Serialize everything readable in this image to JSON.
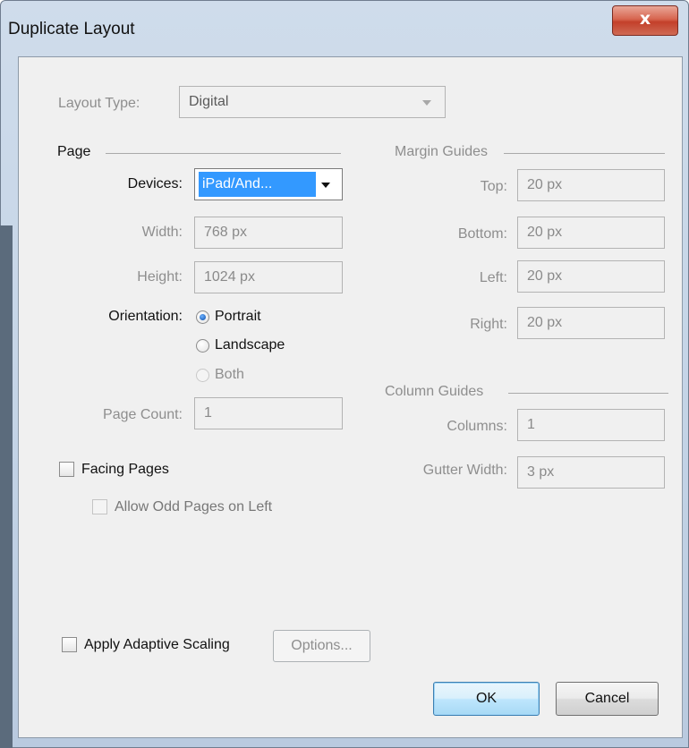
{
  "window": {
    "title": "Duplicate Layout",
    "close_glyph": "x"
  },
  "layout_type": {
    "label": "Layout Type:",
    "value": "Digital"
  },
  "page": {
    "section_label": "Page",
    "devices": {
      "label": "Devices:",
      "value": "iPad/And..."
    },
    "width": {
      "label": "Width:",
      "value": "768 px"
    },
    "height": {
      "label": "Height:",
      "value": "1024 px"
    },
    "orientation": {
      "label": "Orientation:",
      "options": [
        {
          "label": "Portrait",
          "selected": true,
          "enabled": true
        },
        {
          "label": "Landscape",
          "selected": false,
          "enabled": true
        },
        {
          "label": "Both",
          "selected": false,
          "enabled": false
        }
      ]
    },
    "page_count": {
      "label": "Page Count:",
      "value": "1"
    },
    "facing_pages": {
      "label": "Facing Pages",
      "checked": false
    },
    "allow_odd": {
      "label": "Allow Odd Pages on Left",
      "checked": false
    }
  },
  "margin_guides": {
    "section_label": "Margin Guides",
    "top": {
      "label": "Top:",
      "value": "20 px"
    },
    "bottom": {
      "label": "Bottom:",
      "value": "20 px"
    },
    "left": {
      "label": "Left:",
      "value": "20 px"
    },
    "right": {
      "label": "Right:",
      "value": "20 px"
    }
  },
  "column_guides": {
    "section_label": "Column Guides",
    "columns": {
      "label": "Columns:",
      "value": "1"
    },
    "gutter": {
      "label": "Gutter Width:",
      "value": "3 px"
    }
  },
  "adaptive": {
    "label": "Apply Adaptive Scaling",
    "checked": false,
    "options_label": "Options..."
  },
  "buttons": {
    "ok": "OK",
    "cancel": "Cancel"
  },
  "colors": {
    "selection": "#3399ff",
    "close": "#c3402a",
    "default_button_border": "#3c7fb1"
  },
  "icons": [
    "close-icon",
    "dropdown-arrow-icon",
    "radio-icon",
    "checkbox-icon"
  ]
}
